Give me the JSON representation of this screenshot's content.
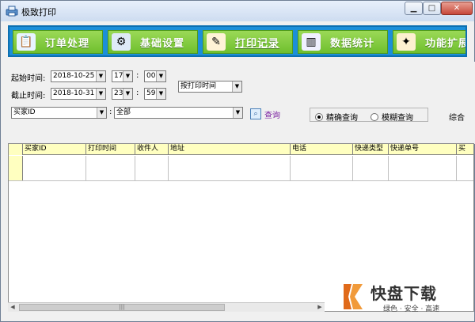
{
  "window": {
    "title": "极致打印",
    "min_glyph": "▁",
    "max_glyph": "□",
    "close_glyph": "✕"
  },
  "toolbar": {
    "items": [
      {
        "label": "订单处理",
        "icon": "order-icon"
      },
      {
        "label": "基础设置",
        "icon": "settings-gear-icon"
      },
      {
        "label": "打印记录",
        "icon": "print-record-icon",
        "active": true
      },
      {
        "label": "数据统计",
        "icon": "bar-chart-icon"
      },
      {
        "label": "功能扩展",
        "icon": "extension-icon"
      }
    ],
    "brand_color": "#1c8fd9",
    "button_color": "#7cc63a"
  },
  "filters": {
    "start_label": "起始时间:",
    "start_date": "2018-10-25",
    "start_hour": "17",
    "start_minute": "00",
    "end_label": "截止时间:",
    "end_date": "2018-10-31",
    "end_hour": "23",
    "end_minute": "59",
    "time_mode": "按打印时间",
    "field_select": "买家ID",
    "value_select": "全部",
    "query_label": "查询",
    "exact_label": "精确查询",
    "fuzzy_label": "模糊查询",
    "exact_selected": true,
    "trailing_label": "综合",
    "colon": ":"
  },
  "grid": {
    "columns": [
      "买家ID",
      "打印时间",
      "收件人",
      "地址",
      "电话",
      "快递类型",
      "快递单号",
      "买"
    ],
    "header_bg": "#ffffc0"
  },
  "scrollbar": {
    "left_arrow": "◀",
    "right_arrow": "▶",
    "grip": "|||"
  },
  "watermark": {
    "brand": "快盘下载",
    "tagline": "绿色 · 安全 · 高速"
  }
}
